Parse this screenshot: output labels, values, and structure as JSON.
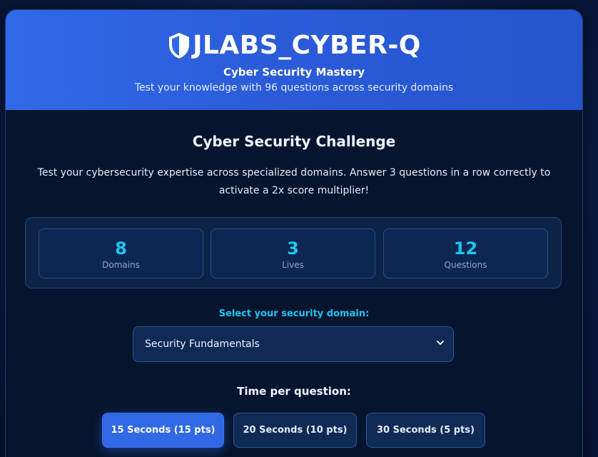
{
  "header": {
    "title": "JLABS_CYBER-Q",
    "subtitle": "Cyber Security Mastery",
    "tagline": "Test your knowledge with 96 questions across security domains",
    "icon": "shield-icon"
  },
  "challenge": {
    "title": "Cyber Security Challenge",
    "description": "Test your cybersecurity expertise across specialized domains. Answer 3 questions in a row correctly to activate a 2x score multiplier!"
  },
  "stats": [
    {
      "value": "8",
      "label": "Domains"
    },
    {
      "value": "3",
      "label": "Lives"
    },
    {
      "value": "12",
      "label": "Questions"
    }
  ],
  "domain_select": {
    "label": "Select your security domain:",
    "selected": "Security Fundamentals"
  },
  "time": {
    "label": "Time per question:",
    "options": [
      {
        "label": "15 Seconds (15 pts)",
        "active": true
      },
      {
        "label": "20 Seconds (10 pts)",
        "active": false
      },
      {
        "label": "30 Seconds (5 pts)",
        "active": false
      }
    ]
  },
  "colors": {
    "header_blue": "#3168e8",
    "accent_cyan": "#1cc6f2",
    "card_bg": "#06152e",
    "active_button": "#3068e6"
  }
}
